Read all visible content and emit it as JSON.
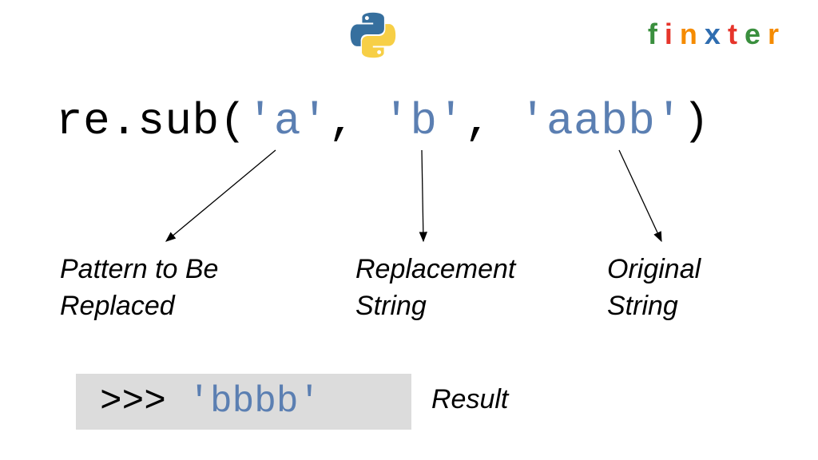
{
  "brand": {
    "letters": [
      {
        "ch": "f",
        "color": "#3a8f3e"
      },
      {
        "ch": "i",
        "color": "#e6352b"
      },
      {
        "ch": "n",
        "color": "#f58b00"
      },
      {
        "ch": "x",
        "color": "#2f6db0"
      },
      {
        "ch": "t",
        "color": "#e6352b"
      },
      {
        "ch": "e",
        "color": "#3a8f3e"
      },
      {
        "ch": "r",
        "color": "#f58b00"
      }
    ]
  },
  "code": {
    "func": "re.sub(",
    "arg1": "'a'",
    "sep1": ", ",
    "arg2": "'b'",
    "sep2": ", ",
    "arg3": "'aabb'",
    "close": ")"
  },
  "labels": {
    "pattern_l1": "Pattern to Be",
    "pattern_l2": "Replaced",
    "repl_l1": "Replacement",
    "repl_l2": "String",
    "orig_l1": "Original",
    "orig_l2": "String",
    "result": "Result"
  },
  "result": {
    "prompt": ">>> ",
    "value": "'bbbb'"
  },
  "icons": {
    "python": "python-logo"
  }
}
